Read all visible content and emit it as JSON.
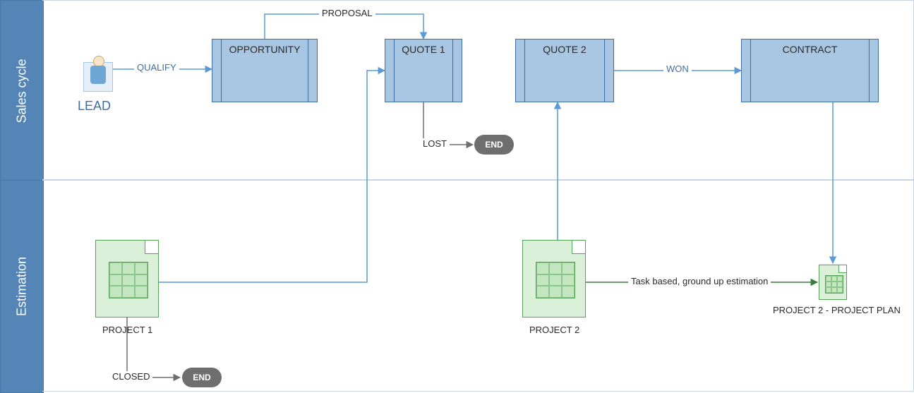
{
  "lanes": {
    "sales": "Sales cycle",
    "estimation": "Estimation"
  },
  "nodes": {
    "lead": "LEAD",
    "opportunity": "OPPORTUNITY",
    "quote1": "QUOTE 1",
    "quote2": "QUOTE 2",
    "contract": "CONTRACT",
    "end1": "END",
    "end2": "END",
    "project1": "PROJECT 1",
    "project2": "PROJECT 2",
    "projectplan": "PROJECT 2 - PROJECT PLAN"
  },
  "edges": {
    "qualify": "QUALIFY",
    "proposal": "PROPOSAL",
    "lost": "LOST",
    "won": "WON",
    "closed": "CLOSED",
    "estimation_label": "Task based, ground up estimation"
  },
  "colors": {
    "lane_header": "#5485b6",
    "process_fill": "#a8c5e2",
    "process_border": "#3c6fa3",
    "doc_fill": "#daf0d8",
    "doc_border": "#56a256",
    "endpill": "#6e6e6e",
    "line_blue": "#5a9bd5",
    "line_green": "#3a7a3a",
    "line_gray": "#6e6e6e"
  }
}
